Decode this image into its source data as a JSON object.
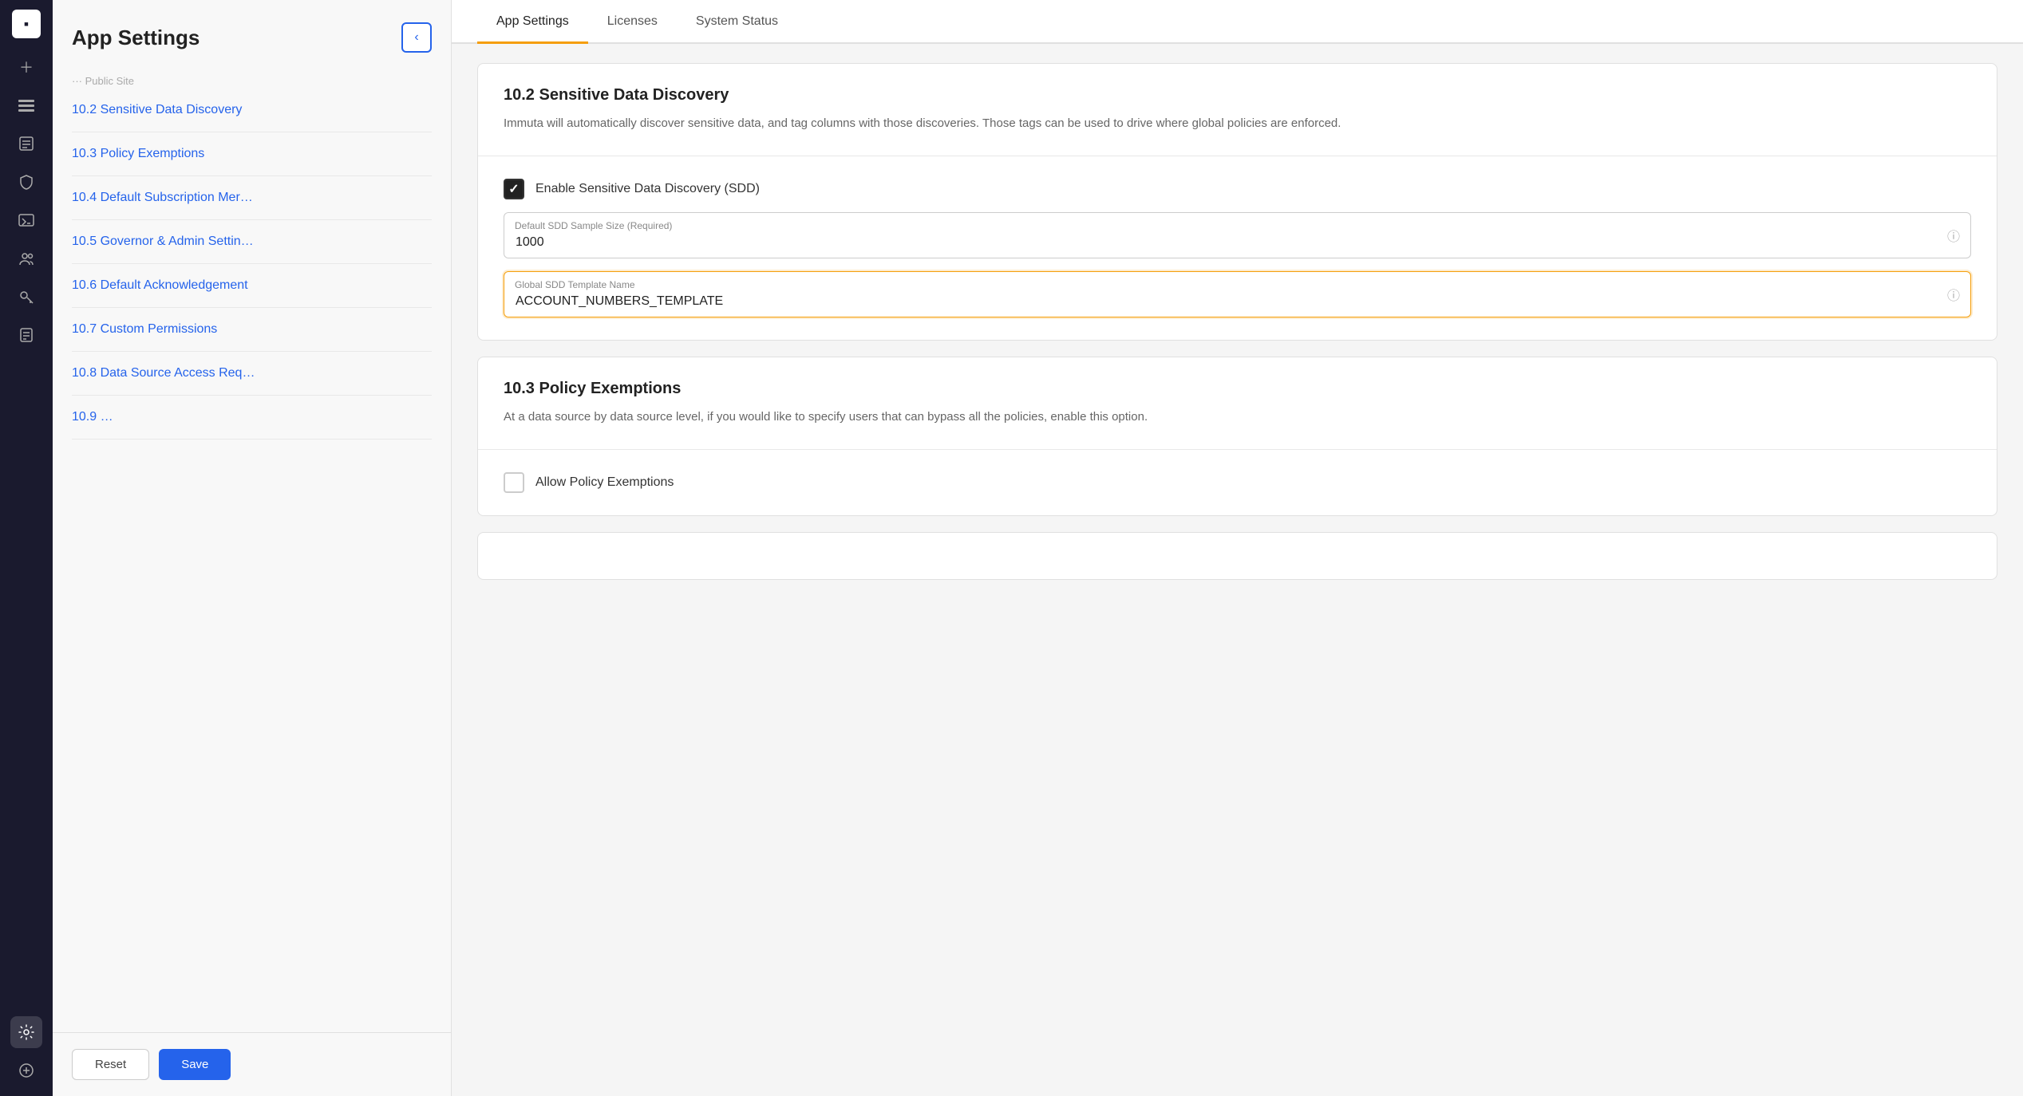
{
  "nav": {
    "logo": "▪",
    "items": [
      {
        "icon": "＋",
        "name": "add",
        "active": false
      },
      {
        "icon": "⊞",
        "name": "layers",
        "active": false
      },
      {
        "icon": "🗂",
        "name": "files",
        "active": false
      },
      {
        "icon": "🛡",
        "name": "shield",
        "active": false
      },
      {
        "icon": ">_",
        "name": "terminal",
        "active": false
      },
      {
        "icon": "👥",
        "name": "users",
        "active": false
      },
      {
        "icon": "🔑",
        "name": "keys",
        "active": false
      },
      {
        "icon": "📋",
        "name": "docs",
        "active": false
      },
      {
        "icon": "⚙",
        "name": "settings",
        "active": true
      },
      {
        "icon": "⊕",
        "name": "bottom-add",
        "active": false
      }
    ]
  },
  "sidebar": {
    "title": "App Settings",
    "collapse_button": "‹",
    "items": [
      {
        "label": "10.2  Sensitive Data Discovery",
        "id": "10.2"
      },
      {
        "label": "10.3  Policy Exemptions",
        "id": "10.3"
      },
      {
        "label": "10.4  Default Subscription Mer…",
        "id": "10.4"
      },
      {
        "label": "10.5  Governor & Admin Settin…",
        "id": "10.5"
      },
      {
        "label": "10.6  Default Acknowledgement",
        "id": "10.6"
      },
      {
        "label": "10.7  Custom Permissions",
        "id": "10.7"
      },
      {
        "label": "10.8  Data Source Access Req…",
        "id": "10.8"
      },
      {
        "label": "10.9  …",
        "id": "10.9"
      }
    ],
    "reset_label": "Reset",
    "save_label": "Save"
  },
  "tabs": [
    {
      "label": "App Settings",
      "active": true
    },
    {
      "label": "Licenses",
      "active": false
    },
    {
      "label": "System Status",
      "active": false
    }
  ],
  "sections": {
    "sdd": {
      "title": "10.2 Sensitive Data Discovery",
      "description": "Immuta will automatically discover sensitive data, and tag columns with those discoveries. Those tags can be used to drive where global policies are enforced.",
      "checkbox_label": "Enable Sensitive Data Discovery (SDD)",
      "checkbox_checked": true,
      "sample_size_label": "Default SDD Sample Size (Required)",
      "sample_size_value": "1000",
      "template_label": "Global SDD Template Name",
      "template_value": "ACCOUNT_NUMBERS_TEMPLATE"
    },
    "policy_exemptions": {
      "title": "10.3 Policy Exemptions",
      "description": "At a data source by data source level, if you would like to specify users that can bypass all the policies, enable this option.",
      "checkbox_label": "Allow Policy Exemptions",
      "checkbox_checked": false
    }
  }
}
